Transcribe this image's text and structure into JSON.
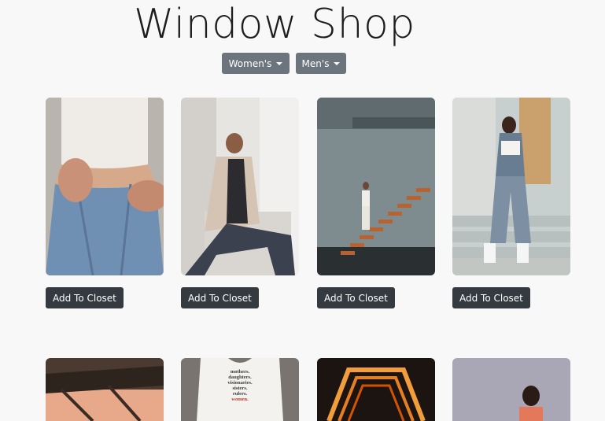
{
  "header": {
    "title": "Window Shop"
  },
  "nav": {
    "womens_label": "Women's",
    "mens_label": "Men's"
  },
  "products": [
    {
      "image": "woman-crop-top-jeans-photo",
      "button_label": "Add To Closet"
    },
    {
      "image": "woman-beige-coat-sitting-photo",
      "button_label": "Add To Closet"
    },
    {
      "image": "woman-on-floating-stairs-photo",
      "button_label": "Add To Closet"
    },
    {
      "image": "woman-denim-outfit-on-steps-photo",
      "button_label": "Add To Closet"
    }
  ],
  "second_row": {
    "tshirt_text": [
      "mothers.",
      "daughters.",
      "visionaries.",
      "sisters.",
      "rulers.",
      "women."
    ]
  },
  "colors": {
    "dropdown_bg": "#6c757d",
    "button_bg": "#343a40",
    "page_bg": "#f8f8f9"
  }
}
